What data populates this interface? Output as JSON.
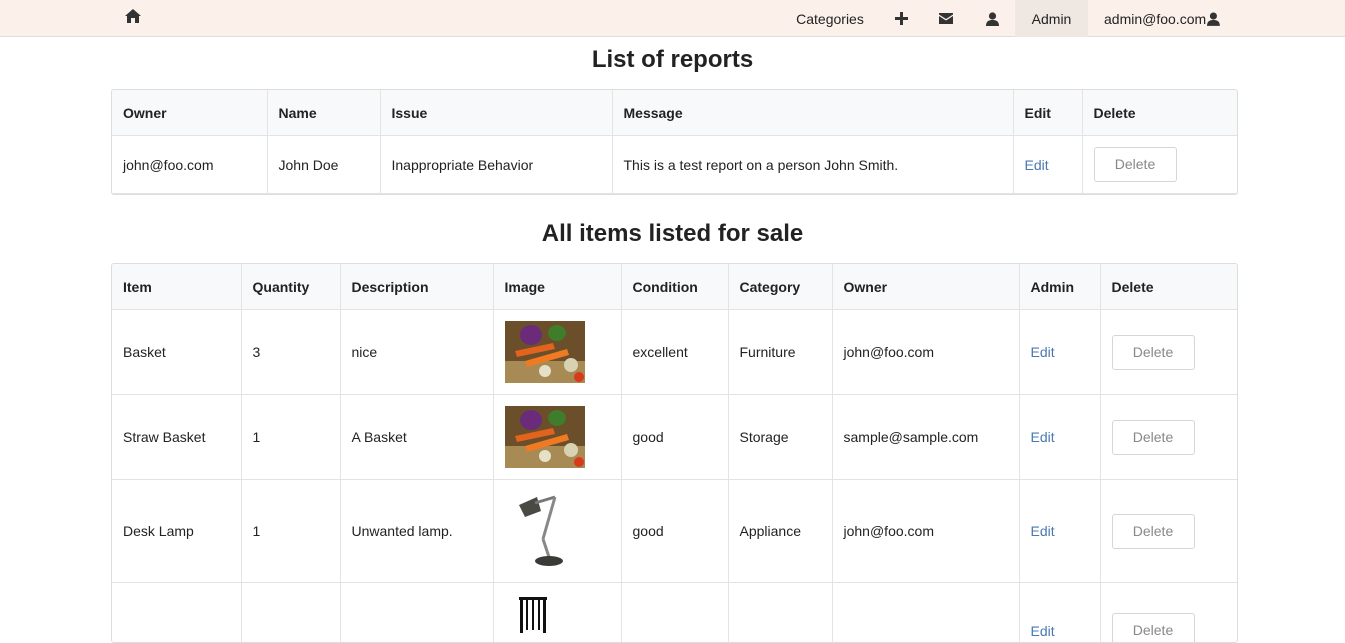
{
  "navbar": {
    "home_icon": "home-icon",
    "categories_label": "Categories",
    "add_icon": "plus-icon",
    "mail_icon": "envelope-icon",
    "profile_icon": "user-icon",
    "admin_label": "Admin",
    "user_email": "admin@foo.com",
    "user_icon": "user-icon"
  },
  "reports": {
    "title": "List of reports",
    "headers": [
      "Owner",
      "Name",
      "Issue",
      "Message",
      "Edit",
      "Delete"
    ],
    "rows": [
      {
        "owner": "john@foo.com",
        "name": "John Doe",
        "issue": "Inappropriate Behavior",
        "message": "This is a test report on a person John Smith.",
        "edit": "Edit",
        "delete": "Delete"
      }
    ]
  },
  "items": {
    "title": "All items listed for sale",
    "headers": [
      "Item",
      "Quantity",
      "Description",
      "Image",
      "Condition",
      "Category",
      "Owner",
      "Admin",
      "Delete"
    ],
    "rows": [
      {
        "item": "Basket",
        "quantity": "3",
        "description": "nice",
        "image": "vegetable-basket-photo",
        "condition": "excellent",
        "category": "Furniture",
        "owner": "john@foo.com",
        "edit": "Edit",
        "delete": "Delete"
      },
      {
        "item": "Straw Basket",
        "quantity": "1",
        "description": "A Basket",
        "image": "vegetable-basket-photo",
        "condition": "good",
        "category": "Storage",
        "owner": "sample@sample.com",
        "edit": "Edit",
        "delete": "Delete"
      },
      {
        "item": "Desk Lamp",
        "quantity": "1",
        "description": "Unwanted lamp.",
        "image": "desk-lamp-photo",
        "condition": "good",
        "category": "Appliance",
        "owner": "john@foo.com",
        "edit": "Edit",
        "delete": "Delete"
      },
      {
        "image": "chair-photo",
        "edit": "Edit",
        "delete": "Delete"
      }
    ]
  }
}
